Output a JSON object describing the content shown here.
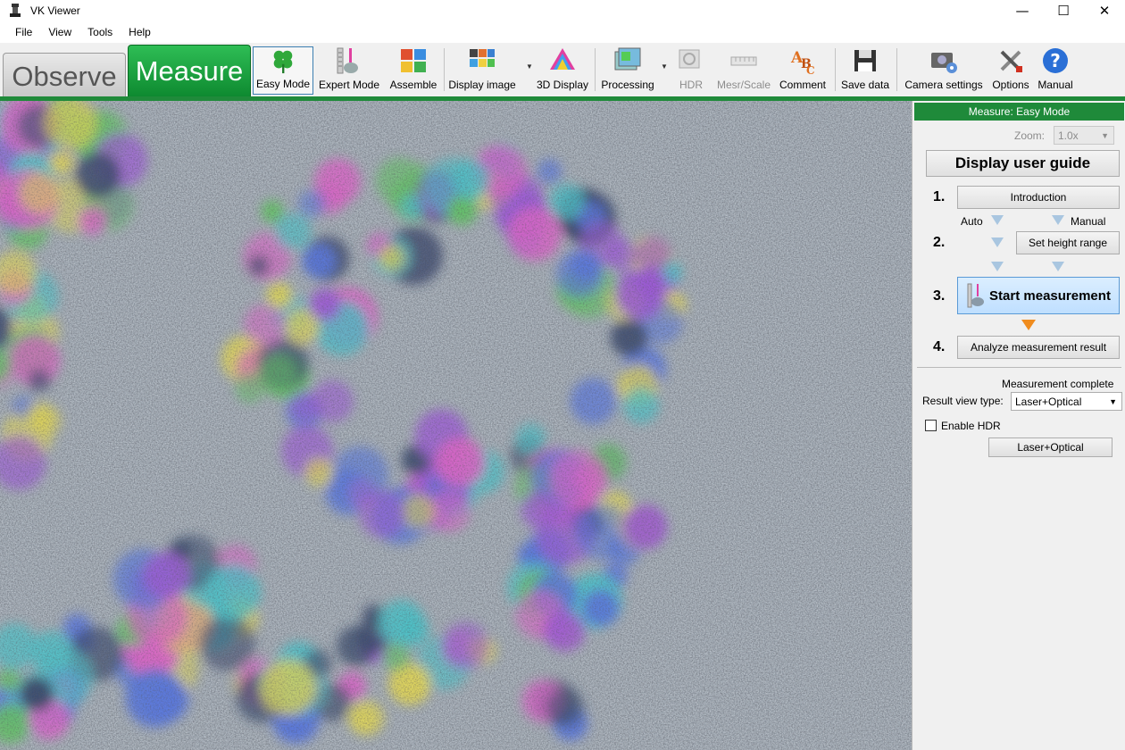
{
  "window": {
    "title": "VK Viewer",
    "controls": {
      "minimize": "—",
      "maximize": "☐",
      "close": "✕"
    }
  },
  "menu": [
    "File",
    "View",
    "Tools",
    "Help"
  ],
  "mode_tabs": {
    "observe": "Observe",
    "measure": "Measure"
  },
  "toolbar": {
    "easy_mode": "Easy Mode",
    "expert_mode": "Expert Mode",
    "assemble": "Assemble",
    "display_image": "Display image",
    "display_3d": "3D Display",
    "processing": "Processing",
    "hdr": "HDR",
    "mesr_scale": "Mesr/Scale",
    "comment": "Comment",
    "save_data": "Save data",
    "camera_settings": "Camera settings",
    "options": "Options",
    "manual": "Manual"
  },
  "panel": {
    "header": "Measure: Easy Mode",
    "zoom_label": "Zoom:",
    "zoom_value": "1.0x",
    "guide_button": "Display user guide",
    "steps": {
      "s1": "1.",
      "s2": "2.",
      "s3": "3.",
      "s4": "4.",
      "intro": "Introduction",
      "auto": "Auto",
      "manual": "Manual",
      "set_height": "Set height range",
      "start": "Start measurement",
      "analyze": "Analyze measurement result"
    },
    "status": "Measurement complete",
    "result_view_label": "Result view type:",
    "result_view_value": "Laser+Optical",
    "enable_hdr": "Enable HDR",
    "laser_button": "Laser+Optical"
  },
  "colors": {
    "accent_green": "#1f8a3a",
    "active_blue": "#bfdfff",
    "step_arrow": "#f08c1e"
  }
}
